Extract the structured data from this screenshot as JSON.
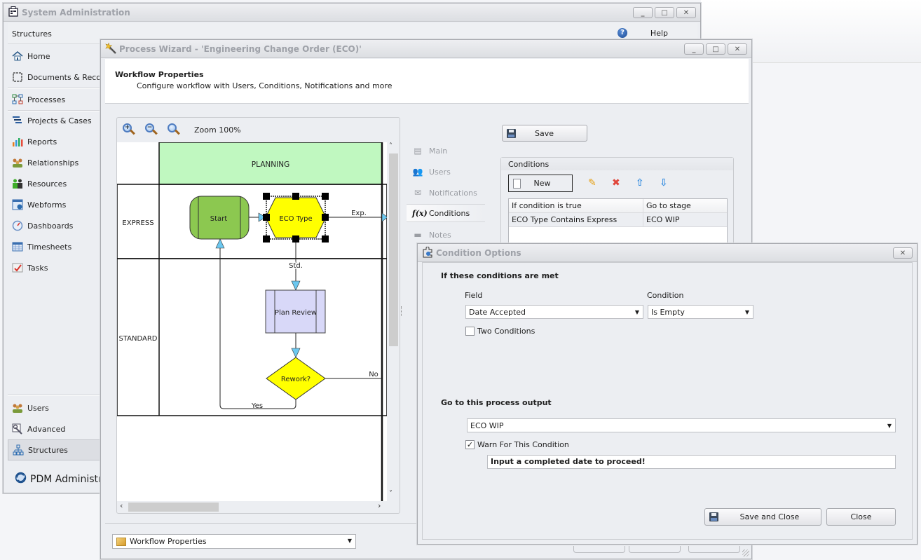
{
  "system_admin": {
    "title": "System Administration",
    "header_label": "Structures",
    "help_label": "Help",
    "nav_items": [
      {
        "label": "Home",
        "icon": "home-icon"
      },
      {
        "label": "Documents & Records",
        "icon": "documents-icon"
      },
      {
        "label": "Processes",
        "icon": "processes-icon",
        "selected": true
      },
      {
        "label": "Projects & Cases",
        "icon": "projects-icon"
      },
      {
        "label": "Reports",
        "icon": "reports-icon"
      },
      {
        "label": "Relationships",
        "icon": "relationships-icon"
      },
      {
        "label": "Resources",
        "icon": "resources-icon"
      },
      {
        "label": "Webforms",
        "icon": "webforms-icon"
      },
      {
        "label": "Dashboards",
        "icon": "dashboards-icon"
      },
      {
        "label": "Timesheets",
        "icon": "timesheets-icon"
      },
      {
        "label": "Tasks",
        "icon": "tasks-icon"
      }
    ],
    "bottom_items": [
      {
        "label": "Users",
        "icon": "users-icon"
      },
      {
        "label": "Advanced",
        "icon": "advanced-icon"
      },
      {
        "label": "Structures",
        "icon": "structures-icon",
        "selected": true
      }
    ],
    "pdm_label": "PDM Administration"
  },
  "wizard": {
    "title": "Process Wizard - 'Engineering Change Order (ECO)'",
    "heading": "Workflow Properties",
    "subheading": "Configure workflow with Users, Conditions, Notifications and more",
    "zoom_label": "Zoom 100%",
    "diagram": {
      "stage_header": "PLANNING",
      "lanes": [
        "EXPRESS",
        "STANDARD"
      ],
      "nodes": {
        "start": "Start",
        "eco_type": "ECO Type",
        "plan_review": "Plan Review",
        "rework": "Rework?"
      },
      "edge_labels": {
        "exp": "Exp.",
        "std": "Std.",
        "no": "No",
        "yes": "Yes"
      }
    },
    "side_nav": [
      {
        "label": "Main",
        "icon": "main-icon"
      },
      {
        "label": "Users",
        "icon": "users-icon"
      },
      {
        "label": "Notifications",
        "icon": "envelope-icon"
      },
      {
        "label": "Conditions",
        "icon": "function-icon",
        "selected": true
      },
      {
        "label": "Notes",
        "icon": "notes-icon"
      }
    ],
    "save_label": "Save",
    "conditions": {
      "group_title": "Conditions",
      "new_label": "New",
      "columns": [
        "If condition is true",
        "Go to stage"
      ],
      "rows": [
        [
          "ECO Type Contains Express",
          "ECO WIP"
        ]
      ]
    },
    "bottom_select": "Workflow Properties"
  },
  "condition_options": {
    "title": "Condition Options",
    "section1": "If these conditions are met",
    "field_label": "Field",
    "field_value": "Date Accepted",
    "condition_label": "Condition",
    "condition_value": "Is Empty",
    "two_conditions_label": "Two Conditions",
    "two_conditions_checked": false,
    "section2": "Go to this process output",
    "output_value": "ECO WIP",
    "warn_label": "Warn For This Condition",
    "warn_checked": true,
    "warn_message": "Input a completed date to proceed!",
    "save_close_label": "Save and Close",
    "close_label": "Close"
  }
}
